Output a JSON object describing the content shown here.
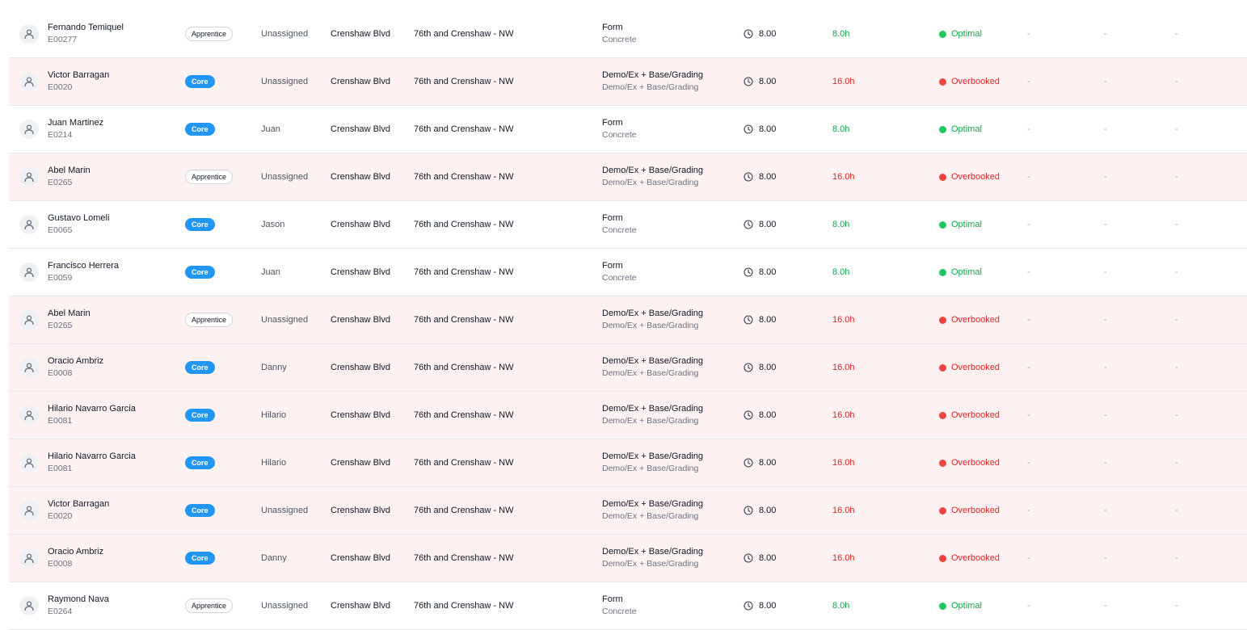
{
  "rows": [
    {
      "name": "Fernando Temiquel",
      "id": "E00277",
      "badge": "Apprentice",
      "foreman": "Unassigned",
      "project": "Crenshaw Blvd",
      "location": "76th and Crenshaw - NW",
      "task": "Form",
      "task_sub": "Concrete",
      "hours": "8.00",
      "total": "8.0h",
      "status": "Optimal",
      "d1": "-",
      "d2": "-",
      "d3": "-"
    },
    {
      "name": "Victor Barragan",
      "id": "E0020",
      "badge": "Core",
      "foreman": "Unassigned",
      "project": "Crenshaw Blvd",
      "location": "76th and Crenshaw - NW",
      "task": "Demo/Ex + Base/Grading",
      "task_sub": "Demo/Ex + Base/Grading",
      "hours": "8.00",
      "total": "16.0h",
      "status": "Overbooked",
      "d1": "-",
      "d2": "-",
      "d3": "-"
    },
    {
      "name": "Juan Martinez",
      "id": "E0214",
      "badge": "Core",
      "foreman": "Juan",
      "project": "Crenshaw Blvd",
      "location": "76th and Crenshaw - NW",
      "task": "Form",
      "task_sub": "Concrete",
      "hours": "8.00",
      "total": "8.0h",
      "status": "Optimal",
      "d1": "-",
      "d2": "-",
      "d3": "-"
    },
    {
      "name": "Abel Marin",
      "id": "E0265",
      "badge": "Apprentice",
      "foreman": "Unassigned",
      "project": "Crenshaw Blvd",
      "location": "76th and Crenshaw - NW",
      "task": "Demo/Ex + Base/Grading",
      "task_sub": "Demo/Ex + Base/Grading",
      "hours": "8.00",
      "total": "16.0h",
      "status": "Overbooked",
      "d1": "-",
      "d2": "-",
      "d3": "-"
    },
    {
      "name": "Gustavo Lomeli",
      "id": "E0065",
      "badge": "Core",
      "foreman": "Jason",
      "project": "Crenshaw Blvd",
      "location": "76th and Crenshaw - NW",
      "task": "Form",
      "task_sub": "Concrete",
      "hours": "8.00",
      "total": "8.0h",
      "status": "Optimal",
      "d1": "-",
      "d2": "-",
      "d3": "-"
    },
    {
      "name": "Francisco Herrera",
      "id": "E0059",
      "badge": "Core",
      "foreman": "Juan",
      "project": "Crenshaw Blvd",
      "location": "76th and Crenshaw - NW",
      "task": "Form",
      "task_sub": "Concrete",
      "hours": "8.00",
      "total": "8.0h",
      "status": "Optimal",
      "d1": "-",
      "d2": "-",
      "d3": "-"
    },
    {
      "name": "Abel Marin",
      "id": "E0265",
      "badge": "Apprentice",
      "foreman": "Unassigned",
      "project": "Crenshaw Blvd",
      "location": "76th and Crenshaw - NW",
      "task": "Demo/Ex + Base/Grading",
      "task_sub": "Demo/Ex + Base/Grading",
      "hours": "8.00",
      "total": "16.0h",
      "status": "Overbooked",
      "d1": "-",
      "d2": "-",
      "d3": "-"
    },
    {
      "name": "Oracio Ambriz",
      "id": "E0008",
      "badge": "Core",
      "foreman": "Danny",
      "project": "Crenshaw Blvd",
      "location": "76th and Crenshaw - NW",
      "task": "Demo/Ex + Base/Grading",
      "task_sub": "Demo/Ex + Base/Grading",
      "hours": "8.00",
      "total": "16.0h",
      "status": "Overbooked",
      "d1": "-",
      "d2": "-",
      "d3": "-"
    },
    {
      "name": "Hilario Navarro Garcia",
      "id": "E0081",
      "badge": "Core",
      "foreman": "Hilario",
      "project": "Crenshaw Blvd",
      "location": "76th and Crenshaw - NW",
      "task": "Demo/Ex + Base/Grading",
      "task_sub": "Demo/Ex + Base/Grading",
      "hours": "8.00",
      "total": "16.0h",
      "status": "Overbooked",
      "d1": "-",
      "d2": "-",
      "d3": "-"
    },
    {
      "name": "Hilario Navarro Garcia",
      "id": "E0081",
      "badge": "Core",
      "foreman": "Hilario",
      "project": "Crenshaw Blvd",
      "location": "76th and Crenshaw - NW",
      "task": "Demo/Ex + Base/Grading",
      "task_sub": "Demo/Ex + Base/Grading",
      "hours": "8.00",
      "total": "16.0h",
      "status": "Overbooked",
      "d1": "-",
      "d2": "-",
      "d3": "-"
    },
    {
      "name": "Victor Barragan",
      "id": "E0020",
      "badge": "Core",
      "foreman": "Unassigned",
      "project": "Crenshaw Blvd",
      "location": "76th and Crenshaw - NW",
      "task": "Demo/Ex + Base/Grading",
      "task_sub": "Demo/Ex + Base/Grading",
      "hours": "8.00",
      "total": "16.0h",
      "status": "Overbooked",
      "d1": "-",
      "d2": "-",
      "d3": "-"
    },
    {
      "name": "Oracio Ambriz",
      "id": "E0008",
      "badge": "Core",
      "foreman": "Danny",
      "project": "Crenshaw Blvd",
      "location": "76th and Crenshaw - NW",
      "task": "Demo/Ex + Base/Grading",
      "task_sub": "Demo/Ex + Base/Grading",
      "hours": "8.00",
      "total": "16.0h",
      "status": "Overbooked",
      "d1": "-",
      "d2": "-",
      "d3": "-"
    },
    {
      "name": "Raymond Nava",
      "id": "E0264",
      "badge": "Apprentice",
      "foreman": "Unassigned",
      "project": "Crenshaw Blvd",
      "location": "76th and Crenshaw - NW",
      "task": "Form",
      "task_sub": "Concrete",
      "hours": "8.00",
      "total": "8.0h",
      "status": "Optimal",
      "d1": "-",
      "d2": "-",
      "d3": "-"
    }
  ],
  "colors": {
    "core_badge": "#2196f3",
    "optimal": "#16a34a",
    "overbooked": "#dc2626",
    "overbooked_row_bg": "#fef1f1"
  },
  "icons": {
    "avatar": "user-avatar-icon",
    "hours": "clock-icon",
    "status": "status-dot-icon"
  }
}
